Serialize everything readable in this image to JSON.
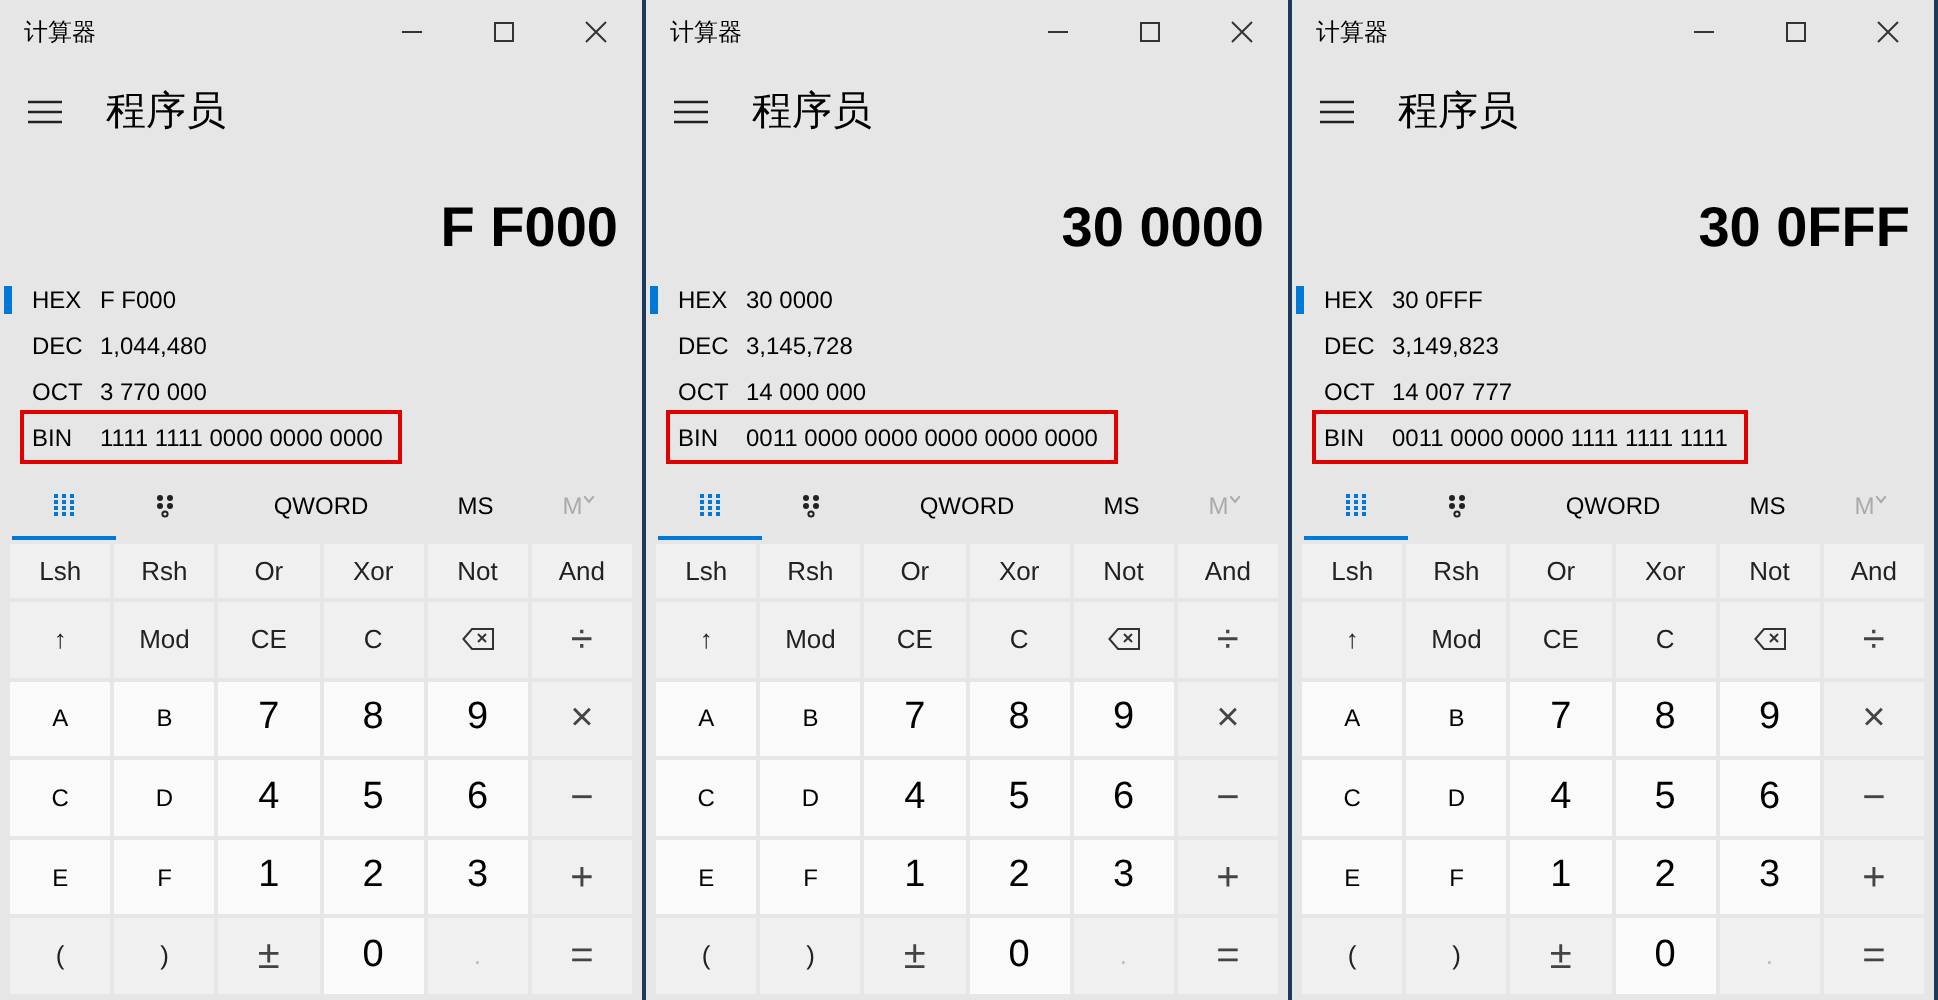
{
  "windows": [
    {
      "title": "计算器",
      "mode": "程序员",
      "display": "F F000",
      "radix": [
        {
          "label": "HEX",
          "value": "F F000",
          "selected": true,
          "highlighted": false
        },
        {
          "label": "DEC",
          "value": "1,044,480",
          "selected": false,
          "highlighted": false
        },
        {
          "label": "OCT",
          "value": "3 770 000",
          "selected": false,
          "highlighted": false
        },
        {
          "label": "BIN",
          "value": "1111 1111 0000 0000 0000",
          "selected": false,
          "highlighted": true
        }
      ],
      "tabs": [
        {
          "kind": "keypad",
          "selected": true
        },
        {
          "kind": "bits",
          "selected": false
        },
        {
          "kind": "text",
          "label": "QWORD",
          "selected": false
        },
        {
          "kind": "text",
          "label": "MS",
          "selected": false
        },
        {
          "kind": "memory",
          "label": "M",
          "selected": false,
          "disabled": true
        }
      ],
      "keys": [
        {
          "label": "Lsh",
          "kind": "fn"
        },
        {
          "label": "Rsh",
          "kind": "fn"
        },
        {
          "label": "Or",
          "kind": "fn"
        },
        {
          "label": "Xor",
          "kind": "fn"
        },
        {
          "label": "Not",
          "kind": "fn"
        },
        {
          "label": "And",
          "kind": "fn"
        },
        {
          "label": "↑",
          "kind": "fn"
        },
        {
          "label": "Mod",
          "kind": "fn"
        },
        {
          "label": "CE",
          "kind": "fn"
        },
        {
          "label": "C",
          "kind": "fn"
        },
        {
          "kind": "backspace"
        },
        {
          "label": "÷",
          "kind": "op"
        },
        {
          "label": "A",
          "kind": "hex"
        },
        {
          "label": "B",
          "kind": "hex"
        },
        {
          "label": "7",
          "kind": "digit"
        },
        {
          "label": "8",
          "kind": "digit"
        },
        {
          "label": "9",
          "kind": "digit"
        },
        {
          "label": "×",
          "kind": "op"
        },
        {
          "label": "C",
          "kind": "hex"
        },
        {
          "label": "D",
          "kind": "hex"
        },
        {
          "label": "4",
          "kind": "digit"
        },
        {
          "label": "5",
          "kind": "digit"
        },
        {
          "label": "6",
          "kind": "digit"
        },
        {
          "label": "−",
          "kind": "op"
        },
        {
          "label": "E",
          "kind": "hex"
        },
        {
          "label": "F",
          "kind": "hex"
        },
        {
          "label": "1",
          "kind": "digit"
        },
        {
          "label": "2",
          "kind": "digit"
        },
        {
          "label": "3",
          "kind": "digit"
        },
        {
          "label": "+",
          "kind": "op"
        },
        {
          "label": "(",
          "kind": "fn"
        },
        {
          "label": ")",
          "kind": "fn"
        },
        {
          "label": "±",
          "kind": "op"
        },
        {
          "label": "0",
          "kind": "digit"
        },
        {
          "label": ".",
          "kind": "disabled"
        },
        {
          "label": "=",
          "kind": "op"
        }
      ]
    },
    {
      "title": "计算器",
      "mode": "程序员",
      "display": "30 0000",
      "radix": [
        {
          "label": "HEX",
          "value": "30 0000",
          "selected": true,
          "highlighted": false
        },
        {
          "label": "DEC",
          "value": "3,145,728",
          "selected": false,
          "highlighted": false
        },
        {
          "label": "OCT",
          "value": "14 000 000",
          "selected": false,
          "highlighted": false
        },
        {
          "label": "BIN",
          "value": "0011 0000 0000 0000 0000 0000",
          "selected": false,
          "highlighted": true
        }
      ],
      "tabs": [
        {
          "kind": "keypad",
          "selected": true
        },
        {
          "kind": "bits",
          "selected": false
        },
        {
          "kind": "text",
          "label": "QWORD",
          "selected": false
        },
        {
          "kind": "text",
          "label": "MS",
          "selected": false
        },
        {
          "kind": "memory",
          "label": "M",
          "selected": false,
          "disabled": true
        }
      ],
      "keys": [
        {
          "label": "Lsh",
          "kind": "fn"
        },
        {
          "label": "Rsh",
          "kind": "fn"
        },
        {
          "label": "Or",
          "kind": "fn"
        },
        {
          "label": "Xor",
          "kind": "fn"
        },
        {
          "label": "Not",
          "kind": "fn"
        },
        {
          "label": "And",
          "kind": "fn"
        },
        {
          "label": "↑",
          "kind": "fn"
        },
        {
          "label": "Mod",
          "kind": "fn"
        },
        {
          "label": "CE",
          "kind": "fn"
        },
        {
          "label": "C",
          "kind": "fn"
        },
        {
          "kind": "backspace"
        },
        {
          "label": "÷",
          "kind": "op"
        },
        {
          "label": "A",
          "kind": "hex"
        },
        {
          "label": "B",
          "kind": "hex"
        },
        {
          "label": "7",
          "kind": "digit"
        },
        {
          "label": "8",
          "kind": "digit"
        },
        {
          "label": "9",
          "kind": "digit"
        },
        {
          "label": "×",
          "kind": "op"
        },
        {
          "label": "C",
          "kind": "hex"
        },
        {
          "label": "D",
          "kind": "hex"
        },
        {
          "label": "4",
          "kind": "digit"
        },
        {
          "label": "5",
          "kind": "digit"
        },
        {
          "label": "6",
          "kind": "digit"
        },
        {
          "label": "−",
          "kind": "op"
        },
        {
          "label": "E",
          "kind": "hex"
        },
        {
          "label": "F",
          "kind": "hex"
        },
        {
          "label": "1",
          "kind": "digit"
        },
        {
          "label": "2",
          "kind": "digit"
        },
        {
          "label": "3",
          "kind": "digit"
        },
        {
          "label": "+",
          "kind": "op"
        },
        {
          "label": "(",
          "kind": "fn"
        },
        {
          "label": ")",
          "kind": "fn"
        },
        {
          "label": "±",
          "kind": "op"
        },
        {
          "label": "0",
          "kind": "digit"
        },
        {
          "label": ".",
          "kind": "disabled"
        },
        {
          "label": "=",
          "kind": "op"
        }
      ]
    },
    {
      "title": "计算器",
      "mode": "程序员",
      "display": "30 0FFF",
      "radix": [
        {
          "label": "HEX",
          "value": "30 0FFF",
          "selected": true,
          "highlighted": false
        },
        {
          "label": "DEC",
          "value": "3,149,823",
          "selected": false,
          "highlighted": false
        },
        {
          "label": "OCT",
          "value": "14 007 777",
          "selected": false,
          "highlighted": false
        },
        {
          "label": "BIN",
          "value": "0011 0000 0000 1111 1111 1111",
          "selected": false,
          "highlighted": true
        }
      ],
      "tabs": [
        {
          "kind": "keypad",
          "selected": true
        },
        {
          "kind": "bits",
          "selected": false
        },
        {
          "kind": "text",
          "label": "QWORD",
          "selected": false
        },
        {
          "kind": "text",
          "label": "MS",
          "selected": false
        },
        {
          "kind": "memory",
          "label": "M",
          "selected": false,
          "disabled": true
        }
      ],
      "keys": [
        {
          "label": "Lsh",
          "kind": "fn"
        },
        {
          "label": "Rsh",
          "kind": "fn"
        },
        {
          "label": "Or",
          "kind": "fn"
        },
        {
          "label": "Xor",
          "kind": "fn"
        },
        {
          "label": "Not",
          "kind": "fn"
        },
        {
          "label": "And",
          "kind": "fn"
        },
        {
          "label": "↑",
          "kind": "fn"
        },
        {
          "label": "Mod",
          "kind": "fn"
        },
        {
          "label": "CE",
          "kind": "fn"
        },
        {
          "label": "C",
          "kind": "fn"
        },
        {
          "kind": "backspace"
        },
        {
          "label": "÷",
          "kind": "op"
        },
        {
          "label": "A",
          "kind": "hex"
        },
        {
          "label": "B",
          "kind": "hex"
        },
        {
          "label": "7",
          "kind": "digit"
        },
        {
          "label": "8",
          "kind": "digit"
        },
        {
          "label": "9",
          "kind": "digit"
        },
        {
          "label": "×",
          "kind": "op"
        },
        {
          "label": "C",
          "kind": "hex"
        },
        {
          "label": "D",
          "kind": "hex"
        },
        {
          "label": "4",
          "kind": "digit"
        },
        {
          "label": "5",
          "kind": "digit"
        },
        {
          "label": "6",
          "kind": "digit"
        },
        {
          "label": "−",
          "kind": "op"
        },
        {
          "label": "E",
          "kind": "hex"
        },
        {
          "label": "F",
          "kind": "hex"
        },
        {
          "label": "1",
          "kind": "digit"
        },
        {
          "label": "2",
          "kind": "digit"
        },
        {
          "label": "3",
          "kind": "digit"
        },
        {
          "label": "+",
          "kind": "op"
        },
        {
          "label": "(",
          "kind": "fn"
        },
        {
          "label": ")",
          "kind": "fn"
        },
        {
          "label": "±",
          "kind": "op"
        },
        {
          "label": "0",
          "kind": "digit"
        },
        {
          "label": ".",
          "kind": "disabled"
        },
        {
          "label": "=",
          "kind": "op"
        }
      ]
    }
  ]
}
